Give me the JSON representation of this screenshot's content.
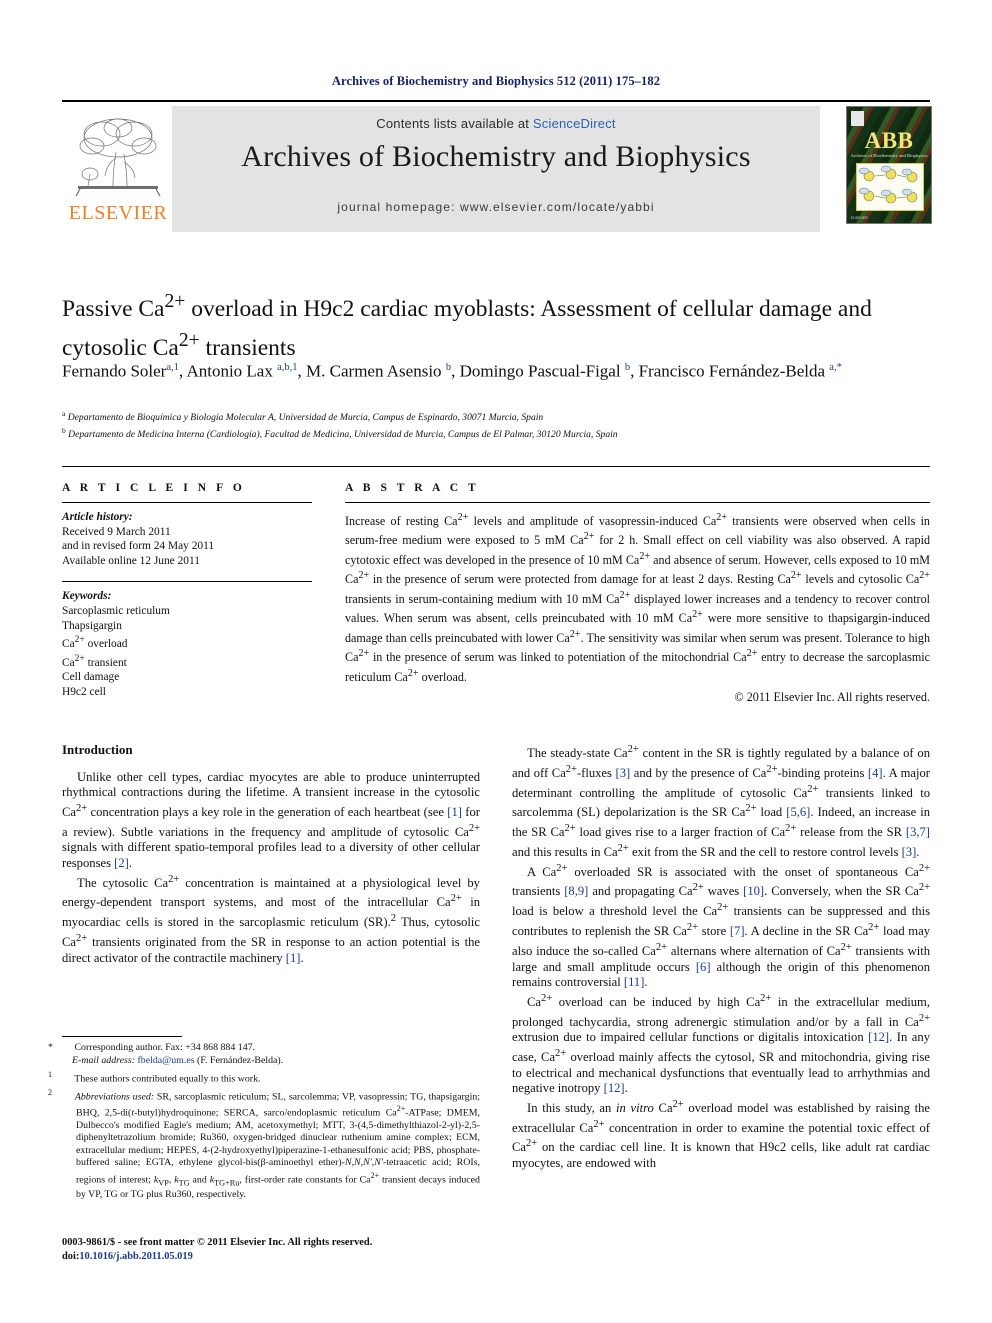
{
  "running_head": "Archives of Biochemistry and Biophysics 512 (2011) 175–182",
  "masthead": {
    "contents_prefix": "Contents lists available at ",
    "sciencedirect": "ScienceDirect",
    "journal_title": "Archives of Biochemistry and Biophysics",
    "homepage": "journal homepage: www.elsevier.com/locate/yabbi",
    "elsevier_wordmark": "ELSEVIER",
    "elsevier_accent_color": "#f08022",
    "link_color": "#2b5fb5",
    "running_head_color": "#14216b"
  },
  "cover": {
    "abbrev": "ABB",
    "subtitle": "Archives of Biochemistry and Biophysics",
    "footer": "ELSEVIER"
  },
  "article": {
    "title_html": "Passive Ca<sup>2+</sup> overload in H9c2 cardiac myoblasts: Assessment of cellular damage and cytosolic Ca<sup>2+</sup> transients",
    "authors_html": "Fernando Soler<sup>a,1</sup>, Antonio Lax <sup>a,b,1</sup>, M. Carmen Asensio <sup>b</sup>, Domingo Pascual-Figal <sup>b</sup>, Francisco Fernández-Belda <sup>a,*</sup>",
    "affiliations": [
      "a Departamento de Bioquímica y Biología Molecular A, Universidad de Murcia, Campus de Espinardo, 30071 Murcia, Spain",
      "b Departamento de Medicina Interna (Cardiología), Facultad de Medicina, Universidad de Murcia, Campus de El Palmar, 30120 Murcia, Spain"
    ]
  },
  "article_info": {
    "heading": "A R T I C L E    I N F O",
    "history_label": "Article history:",
    "history": [
      "Received 9 March 2011",
      "and in revised form 24 May 2011",
      "Available online 12 June 2011"
    ],
    "keywords_label": "Keywords:",
    "keywords_html": [
      "Sarcoplasmic reticulum",
      "Thapsigargin",
      "Ca<sup>2+</sup> overload",
      "Ca<sup>2+</sup> transient",
      "Cell damage",
      "H9c2 cell"
    ]
  },
  "abstract": {
    "heading": "A B S T R A C T",
    "text_html": "Increase of resting Ca<sup>2+</sup> levels and amplitude of vasopressin-induced Ca<sup>2+</sup> transients were observed when cells in serum-free medium were exposed to 5 mM Ca<sup>2+</sup> for 2 h. Small effect on cell viability was also observed. A rapid cytotoxic effect was developed in the presence of 10 mM Ca<sup>2+</sup> and absence of serum. However, cells exposed to 10 mM Ca<sup>2+</sup> in the presence of serum were protected from damage for at least 2 days. Resting Ca<sup>2+</sup> levels and cytosolic Ca<sup>2+</sup> transients in serum-containing medium with 10 mM Ca<sup>2+</sup> displayed lower increases and a tendency to recover control values. When serum was absent, cells preincubated with 10 mM Ca<sup>2+</sup> were more sensitive to thapsigargin-induced damage than cells preincubated with lower Ca<sup>2+</sup>. The sensitivity was similar when serum was present. Tolerance to high Ca<sup>2+</sup> in the presence of serum was linked to potentiation of the mitochondrial Ca<sup>2+</sup> entry to decrease the sarcoplasmic reticulum Ca<sup>2+</sup> overload.",
    "copyright": "© 2011 Elsevier Inc. All rights reserved."
  },
  "introduction": {
    "heading": "Introduction",
    "left_paragraphs_html": [
      "Unlike other cell types, cardiac myocytes are able to produce uninterrupted rhythmical contractions during the lifetime. A transient increase in the cytosolic Ca<sup>2+</sup> concentration plays a key role in the generation of each heartbeat (see <span class=\"ref\">[1]</span> for a review). Subtle variations in the frequency and amplitude of cytosolic Ca<sup>2+</sup> signals with different spatio-temporal profiles lead to a diversity of other cellular responses <span class=\"ref\">[2]</span>.",
      "The cytosolic Ca<sup>2+</sup> concentration is maintained at a physiological level by energy-dependent transport systems, and most of the intracellular Ca<sup>2+</sup> in myocardiac cells is stored in the sarcoplasmic reticulum (SR).<sup>2</sup> Thus, cytosolic Ca<sup>2+</sup> transients originated from the SR in response to an action potential is the direct activator of the contractile machinery <span class=\"ref\">[1]</span>."
    ],
    "right_paragraphs_html": [
      "The steady-state Ca<sup>2+</sup> content in the SR is tightly regulated by a balance of on and off Ca<sup>2+</sup>-fluxes <span class=\"ref\">[3]</span> and by the presence of Ca<sup>2+</sup>-binding proteins <span class=\"ref\">[4]</span>. A major determinant controlling the amplitude of cytosolic Ca<sup>2+</sup> transients linked to sarcolemma (SL) depolarization is the SR Ca<sup>2+</sup> load <span class=\"ref\">[5,6]</span>. Indeed, an increase in the SR Ca<sup>2+</sup> load gives rise to a larger fraction of Ca<sup>2+</sup> release from the SR <span class=\"ref\">[3,7]</span> and this results in Ca<sup>2+</sup> exit from the SR and the cell to restore control levels <span class=\"ref\">[3]</span>.",
      "A Ca<sup>2+</sup> overloaded SR is associated with the onset of spontaneous Ca<sup>2+</sup> transients <span class=\"ref\">[8,9]</span> and propagating Ca<sup>2+</sup> waves <span class=\"ref\">[10]</span>. Conversely, when the SR Ca<sup>2+</sup> load is below a threshold level the Ca<sup>2+</sup> transients can be suppressed and this contributes to replenish the SR Ca<sup>2+</sup> store <span class=\"ref\">[7]</span>. A decline in the SR Ca<sup>2+</sup> load may also induce the so-called Ca<sup>2+</sup> alternans where alternation of Ca<sup>2+</sup> transients with large and small amplitude occurs <span class=\"ref\">[6]</span> although the origin of this phenomenon remains controversial <span class=\"ref\">[11]</span>.",
      "Ca<sup>2+</sup> overload can be induced by high Ca<sup>2+</sup> in the extracellular medium, prolonged tachycardia, strong adrenergic stimulation and/or by a fall in Ca<sup>2+</sup> extrusion due to impaired cellular functions or digitalis intoxication <span class=\"ref\">[12]</span>. In any case, Ca<sup>2+</sup> overload mainly affects the cytosol, SR and mitochondria, giving rise to electrical and mechanical dysfunctions that eventually lead to arrhythmias and negative inotropy <span class=\"ref\">[12]</span>.",
      "In this study, an <i>in vitro</i> Ca<sup>2+</sup> overload model was established by raising the extracellular Ca<sup>2+</sup> concentration in order to examine the potential toxic effect of Ca<sup>2+</sup> on the cardiac cell line. It is known that H9c2 cells, like adult rat cardiac myocytes, are endowed with"
    ]
  },
  "footnotes": {
    "corresponding_html": "<span class=\"fn-mark\">*</span> Corresponding author. Fax: +34 868 884 147.",
    "email_html": "<span class=\"fn-mark\"></span><i>E-mail address:</i> <span class=\"email-link\">fbelda@um.es</span> (F. Fernández-Belda).",
    "equal_contrib_html": "<span class=\"fn-mark\"><sup>1</sup></span> These authors contributed equally to this work.",
    "abbreviations_html": "<span class=\"fn-mark\"><sup>2</sup></span> <i>Abbreviations used:</i> SR, sarcoplasmic reticulum; SL, sarcolemma; VP, vasopressin; TG, thapsigargin; BHQ, 2,5-di(<i>t</i>-butyl)hydroquinone; SERCA, sarco/endoplasmic reticulum Ca<sup>2+</sup>-ATPase; DMEM, Dulbecco's modified Eagle's medium; AM, acetoxymethyl; MTT, 3-(4,5-dimethylthiazol-2-yl)-2,5-diphenyltetrazolium bromide; Ru360, oxygen-bridged dinuclear ruthenium amine complex; ECM, extracellular medium; HEPES, 4-(2-hydroxyethyl)piperazine-1-ethanesulfonic acid; PBS, phosphate-buffered saline; EGTA, ethylene glycol-bis(β-aminoethyl ether)-<i>N,N,N',N'</i>-tetraacetic acid; ROIs, regions of interest; <i>k</i><sub>VP</sub>, <i>k</i><sub>TG</sub> and <i>k</i><sub>TG+Ru</sub>, first-order rate constants for Ca<sup>2+</sup> transient decays induced by VP, TG or TG plus Ru360, respectively."
  },
  "footer": {
    "issn_line": "0003-9861/$ - see front matter © 2011 Elsevier Inc. All rights reserved.",
    "doi_prefix": "doi:",
    "doi": "10.1016/j.abb.2011.05.019"
  }
}
